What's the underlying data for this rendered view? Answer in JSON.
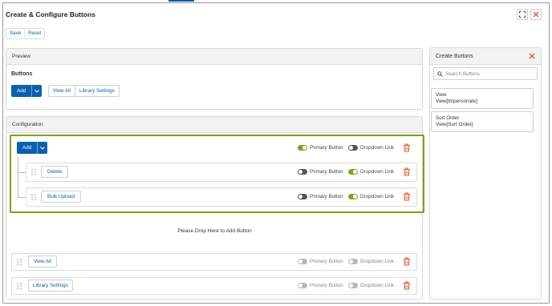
{
  "window": {
    "title": "Create & Configure Buttons",
    "expand_icon": "expand-icon",
    "close_icon": "close-icon"
  },
  "toolbar": {
    "save_label": "Save",
    "reset_label": "Reset"
  },
  "preview": {
    "header": "Preview",
    "buttons_label": "Buttons",
    "add_label": "Add",
    "view_all_label": "View All",
    "library_settings_label": "Library Settings"
  },
  "configuration": {
    "header": "Configuration",
    "group": {
      "add_label": "Add",
      "primary_label": "Primary Button",
      "dropdown_label": "Dropdown Link",
      "children": [
        {
          "label": "Delete",
          "primary_label": "Primary Button",
          "dropdown_label": "Dropdown Link"
        },
        {
          "label": "Bulk Upload",
          "primary_label": "Primary Button",
          "dropdown_label": "Dropdown Link"
        }
      ]
    },
    "drop_text": "Please Drop Here to Add Button",
    "rows": [
      {
        "label": "View All",
        "primary_label": "Primary Button",
        "dropdown_label": "Dropdown Link"
      },
      {
        "label": "Library Settings",
        "primary_label": "Primary Button",
        "dropdown_label": "Dropdown Link"
      }
    ]
  },
  "sidebar": {
    "header": "Create Buttons",
    "search_placeholder": "Search Buttons",
    "items": [
      {
        "title": "View",
        "subtitle": "View[Impersonate]"
      },
      {
        "title": "Sort Order",
        "subtitle": "View[Sort Order]"
      }
    ]
  },
  "colors": {
    "accent": "#0a5fb0",
    "toggle_on": "#79a829",
    "highlight_border": "#7aa21e",
    "danger": "#e2542a"
  }
}
